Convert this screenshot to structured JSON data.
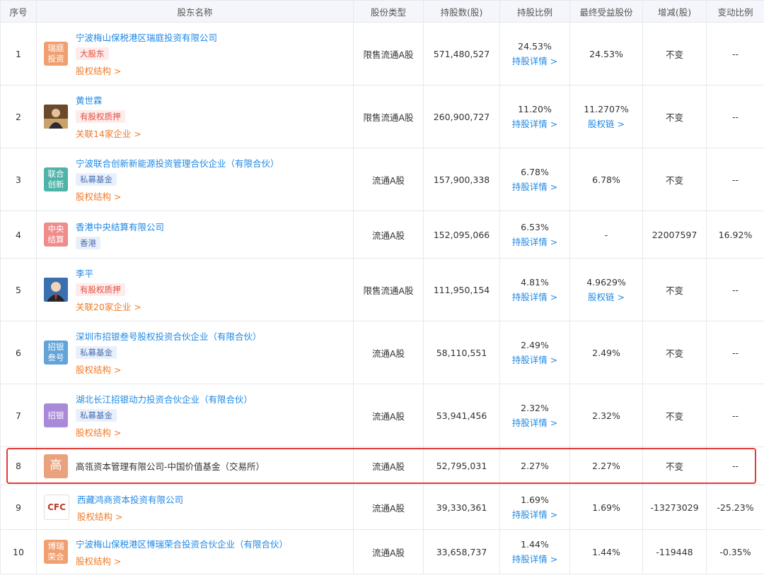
{
  "headers": [
    "序号",
    "股东名称",
    "股份类型",
    "持股数(股)",
    "持股比例",
    "最终受益股份",
    "增减(股)",
    "变动比例"
  ],
  "rows": [
    {
      "no": "1",
      "logo_text": "瑞庭投资",
      "logo_color": "#f0a070",
      "name": "宁波梅山保税港区瑞庭投资有限公司",
      "tag": "大股东",
      "tag_style": "red",
      "sub": "股权结构 >",
      "type": "限售流通A股",
      "shares": "571,480,527",
      "ratio": "24.53%",
      "ratio_link": "持股详情 >",
      "final": "24.53%",
      "final_link": "",
      "change": "不变",
      "change_ratio": "--"
    },
    {
      "no": "2",
      "photo": true,
      "name": "黄世霖",
      "tag": "有股权质押",
      "tag_style": "red",
      "sub": "关联14家企业 >",
      "type": "限售流通A股",
      "shares": "260,900,727",
      "ratio": "11.20%",
      "ratio_link": "持股详情 >",
      "final": "11.2707%",
      "final_link": "股权链 >",
      "change": "不变",
      "change_ratio": "--"
    },
    {
      "no": "3",
      "logo_text": "联合创新",
      "logo_color": "#4fb3a8",
      "name": "宁波联合创新新能源投资管理合伙企业（有限合伙）",
      "tag": "私募基金",
      "tag_style": "blue",
      "sub": "股权结构 >",
      "type": "流通A股",
      "shares": "157,900,338",
      "ratio": "6.78%",
      "ratio_link": "持股详情 >",
      "final": "6.78%",
      "final_link": "",
      "change": "不变",
      "change_ratio": "--"
    },
    {
      "no": "4",
      "logo_text": "中央结算",
      "logo_color": "#ef8c8c",
      "name": "香港中央结算有限公司",
      "tag": "香港",
      "tag_style": "blue",
      "sub": "",
      "type": "流通A股",
      "shares": "152,095,066",
      "ratio": "6.53%",
      "ratio_link": "持股详情 >",
      "final": "-",
      "final_link": "",
      "change": "22007597",
      "change_ratio": "16.92%"
    },
    {
      "no": "5",
      "photo": true,
      "name": "李平",
      "tag": "有股权质押",
      "tag_style": "red",
      "sub": "关联20家企业 >",
      "type": "限售流通A股",
      "shares": "111,950,154",
      "ratio": "4.81%",
      "ratio_link": "持股详情 >",
      "final": "4.9629%",
      "final_link": "股权链 >",
      "change": "不变",
      "change_ratio": "--"
    },
    {
      "no": "6",
      "logo_text": "招银叁号",
      "logo_color": "#62a3d8",
      "name": "深圳市招银叁号股权投资合伙企业（有限合伙）",
      "tag": "私募基金",
      "tag_style": "blue",
      "sub": "股权结构 >",
      "type": "流通A股",
      "shares": "58,110,551",
      "ratio": "2.49%",
      "ratio_link": "持股详情 >",
      "final": "2.49%",
      "final_link": "",
      "change": "不变",
      "change_ratio": "--"
    },
    {
      "no": "7",
      "logo_text": "招银",
      "logo_color": "#a88ad8",
      "name": "湖北长江招银动力投资合伙企业（有限合伙）",
      "tag": "私募基金",
      "tag_style": "blue",
      "sub": "股权结构 >",
      "type": "流通A股",
      "shares": "53,941,456",
      "ratio": "2.32%",
      "ratio_link": "持股详情 >",
      "final": "2.32%",
      "final_link": "",
      "change": "不变",
      "change_ratio": "--"
    },
    {
      "no": "8",
      "logo_text": "高",
      "logo_color": "#e9a27c",
      "name": "高瓴资本管理有限公司-中国价值基金（交易所）",
      "tag": "",
      "tag_style": "",
      "sub": "",
      "type": "流通A股",
      "shares": "52,795,031",
      "ratio": "2.27%",
      "ratio_link": "",
      "final": "2.27%",
      "final_link": "",
      "change": "不变",
      "change_ratio": "--"
    },
    {
      "no": "9",
      "logo_text": "CFC",
      "logo_color": "#ffffff",
      "name": "西藏鸿商资本投资有限公司",
      "tag": "",
      "tag_style": "",
      "sub": "股权结构 >",
      "type": "流通A股",
      "shares": "39,330,361",
      "ratio": "1.69%",
      "ratio_link": "持股详情 >",
      "final": "1.69%",
      "final_link": "",
      "change": "-13273029",
      "change_ratio": "-25.23%"
    },
    {
      "no": "10",
      "logo_text": "博瑞荣合",
      "logo_color": "#f0a070",
      "name": "宁波梅山保税港区博瑞荣合投资合伙企业（有限合伙）",
      "tag": "",
      "tag_style": "",
      "sub": "股权结构 >",
      "type": "流通A股",
      "shares": "33,658,737",
      "ratio": "1.44%",
      "ratio_link": "持股详情 >",
      "final": "1.44%",
      "final_link": "",
      "change": "-119448",
      "change_ratio": "-0.35%"
    }
  ]
}
